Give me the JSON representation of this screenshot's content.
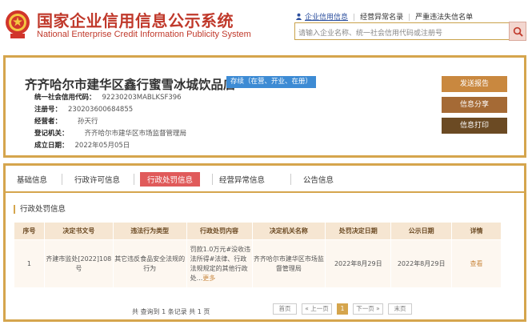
{
  "header": {
    "title_cn": "国家企业信用信息公示系统",
    "title_en": "National Enterprise Credit Information Publicity System",
    "links": [
      "企业信用信息",
      "经营异常名录",
      "严重违法失信名单"
    ],
    "search_placeholder": "请输入企业名称、统一社会信用代码或注册号",
    "brand_color": "#c0392b"
  },
  "company": {
    "name": "齐齐哈尔市建华区鑫行蜜雪冰城饮品店",
    "status": "存续（在营、开业、在册）",
    "fields": [
      {
        "label": "统一社会信用代码：",
        "value": "92230203MABLKSF396"
      },
      {
        "label": "注册号：",
        "value": "230203600684855"
      },
      {
        "label": "经营者：",
        "value": "孙天行"
      },
      {
        "label": "登记机关：",
        "value": "齐齐哈尔市建华区市场监督管理局"
      },
      {
        "label": "成立日期：",
        "value": "2022年05月05日"
      }
    ],
    "actions": [
      "发送报告",
      "信息分享",
      "信息打印"
    ]
  },
  "tabs": [
    "基础信息",
    "行政许可信息",
    "行政处罚信息",
    "经营异常信息",
    "公告信息"
  ],
  "active_tab": "行政处罚信息",
  "section_title": "行政处罚信息",
  "table": {
    "headers": [
      "序号",
      "决定书文号",
      "违法行为类型",
      "行政处罚内容",
      "决定机关名称",
      "处罚决定日期",
      "公示日期",
      "详情"
    ],
    "rows": [
      {
        "no": "1",
        "doc_no": "齐建市监处[2022]108号",
        "violation": "其它违反食品安全法规的行为",
        "content": "罚款1.0万元#没收违法所得#法律、行政法规规定的其他行政处...",
        "more": "更多",
        "authority": "齐齐哈尔市建华区市场监督管理局",
        "decision_date": "2022年8月29日",
        "publish_date": "2022年8月29日",
        "detail": "查看"
      }
    ]
  },
  "pager": {
    "total": "共 查询到 1 条记录 共 1 页",
    "first": "首页",
    "prev": "« 上一页",
    "current": "1",
    "next": "下一页 »",
    "last": "末页"
  }
}
